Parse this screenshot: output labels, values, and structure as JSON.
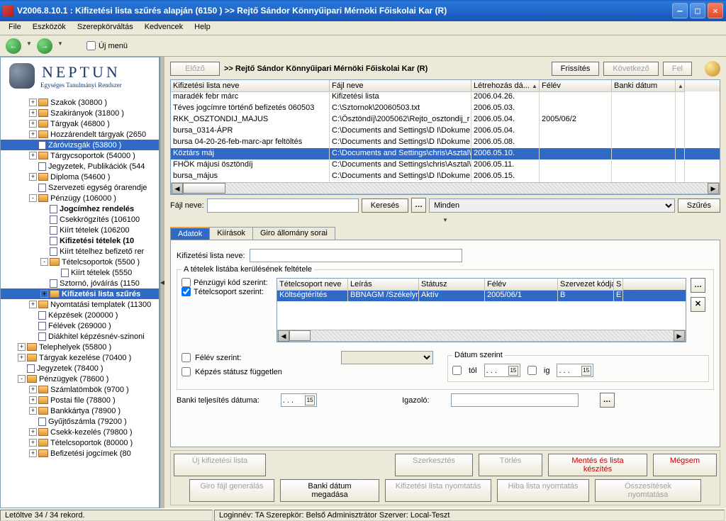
{
  "window": {
    "title": "V2006.8.10.1 : Kifizetési lista szűrés alapján (6150  )   >> Rejtő Sándor Könnyűipari Mérnöki Főiskolai Kar (R)"
  },
  "menu": [
    "File",
    "Eszközök",
    "Szerepkörváltás",
    "Kedvencek",
    "Help"
  ],
  "ujmenu": "Új menü",
  "logo": {
    "name": "NEPTUN",
    "sub": "Egységes Tanulmányi Rendszer"
  },
  "tree": [
    {
      "d": 2,
      "ex": "+",
      "i": "b",
      "t": "Szakok (30800  )"
    },
    {
      "d": 2,
      "ex": "+",
      "i": "b",
      "t": "Szakirányok (31800  )"
    },
    {
      "d": 2,
      "ex": "+",
      "i": "b",
      "t": "Tárgyak (46800  )"
    },
    {
      "d": 2,
      "ex": "+",
      "i": "b",
      "t": "Hozzárendelt tárgyak (2650"
    },
    {
      "d": 2,
      "ex": "",
      "i": "d",
      "t": "Záróvizsgák (53800  )",
      "sel": true
    },
    {
      "d": 2,
      "ex": "+",
      "i": "b",
      "t": "Tárgycsoportok (54000  )"
    },
    {
      "d": 2,
      "ex": "",
      "i": "d",
      "t": "Jegyzetek, Publikációk (544"
    },
    {
      "d": 2,
      "ex": "+",
      "i": "b",
      "t": "Diploma (54600  )"
    },
    {
      "d": 2,
      "ex": "",
      "i": "d",
      "t": "Szervezeti egység órarendje"
    },
    {
      "d": 2,
      "ex": "-",
      "i": "b",
      "t": "Pénzügy (106000  )"
    },
    {
      "d": 3,
      "ex": "",
      "i": "d",
      "t": "Jogcímhez rendelés",
      "bold": true
    },
    {
      "d": 3,
      "ex": "",
      "i": "d",
      "t": "Csekkrögzítés (106100"
    },
    {
      "d": 3,
      "ex": "",
      "i": "d",
      "t": "Kiírt tételek (106200"
    },
    {
      "d": 3,
      "ex": "",
      "i": "d",
      "t": "Kifizetési tételek (10",
      "bold": true
    },
    {
      "d": 3,
      "ex": "",
      "i": "d",
      "t": "Kiírt tételhez befizető rer"
    },
    {
      "d": 3,
      "ex": "-",
      "i": "b",
      "t": "Tételcsoportok (5500  )"
    },
    {
      "d": 4,
      "ex": "",
      "i": "d",
      "t": "Kiírt tételek (5550"
    },
    {
      "d": 3,
      "ex": "",
      "i": "d",
      "t": "Sztornó, jóváírás (1150"
    },
    {
      "d": 3,
      "ex": "+",
      "i": "b",
      "t": "Kifizetési lista szűrés",
      "sel": true,
      "bold": true
    },
    {
      "d": 2,
      "ex": "+",
      "i": "b",
      "t": "Nyomtatási templatek (11300"
    },
    {
      "d": 2,
      "ex": "",
      "i": "d",
      "t": "Képzések (200000  )"
    },
    {
      "d": 2,
      "ex": "",
      "i": "d",
      "t": "Félévek (269000  )"
    },
    {
      "d": 2,
      "ex": "",
      "i": "d",
      "t": "Diákhitel képzésnév-szinoni"
    },
    {
      "d": 1,
      "ex": "+",
      "i": "b",
      "t": "Telephelyek (55800  )"
    },
    {
      "d": 1,
      "ex": "+",
      "i": "b",
      "t": "Tárgyak kezelése (70400  )"
    },
    {
      "d": 1,
      "ex": "",
      "i": "d",
      "t": "Jegyzetek (78400  )"
    },
    {
      "d": 1,
      "ex": "-",
      "i": "b",
      "t": "Pénzügyek (78600  )"
    },
    {
      "d": 2,
      "ex": "+",
      "i": "b",
      "t": "Számlatömbök (9700  )"
    },
    {
      "d": 2,
      "ex": "+",
      "i": "b",
      "t": "Postai file (78800  )"
    },
    {
      "d": 2,
      "ex": "+",
      "i": "b",
      "t": "Bankkártya (78900  )"
    },
    {
      "d": 2,
      "ex": "",
      "i": "d",
      "t": "Gyűjtőszámla (79200  )"
    },
    {
      "d": 2,
      "ex": "+",
      "i": "b",
      "t": "Csekk-kezelés (79800  )"
    },
    {
      "d": 2,
      "ex": "+",
      "i": "b",
      "t": "Tételcsoportok (80000  )"
    },
    {
      "d": 2,
      "ex": "+",
      "i": "b",
      "t": "Befizetési jogcímek (80"
    }
  ],
  "topbtns": {
    "prev": "Előző",
    "path": ">> Rejtő Sándor Könnyűipari Mérnöki Főiskolai Kar (R)",
    "refresh": "Frissítés",
    "next": "Következő",
    "up": "Fel"
  },
  "tableHeaders": [
    "Kifizetési lista neve",
    "Fájl neve",
    "Létrehozás dá...",
    "Félév",
    "Banki dátum"
  ],
  "rows": [
    {
      "n": "maradék febr márc",
      "f": "Kifizetési lista",
      "d": "2006.04.26.",
      "fv": "",
      "b": ""
    },
    {
      "n": "Téves jogcímre történő befizetés 060503",
      "f": "C:\\Sztornok\\20060503.txt",
      "d": "2006.05.03.",
      "fv": "",
      "b": ""
    },
    {
      "n": "RKK_OSZTONDIJ_MAJUS",
      "f": "C:\\Ösztöndíj\\2005062\\Rejto_osztondij_r",
      "d": "2006.05.04.",
      "fv": "2005/06/2",
      "b": ""
    },
    {
      "n": "bursa_0314-ÁPR",
      "f": "C:\\Documents and Settings\\D I\\Dokume",
      "d": "2006.05.04.",
      "fv": "",
      "b": ""
    },
    {
      "n": "bursa 04-20-26-feb-marc-apr feltöltés",
      "f": "C:\\Documents and Settings\\D I\\Dokume",
      "d": "2006.05.08.",
      "fv": "",
      "b": ""
    },
    {
      "n": "Köztárs máj",
      "f": "C:\\Documents and Settings\\chris\\Asztal\\",
      "d": "2006.05.10.",
      "fv": "",
      "b": "",
      "sel": true
    },
    {
      "n": "FHÖK májusi ösztöndíj",
      "f": "C:\\Documents and Settings\\chris\\Asztal\\",
      "d": "2006.05.11.",
      "fv": "",
      "b": ""
    },
    {
      "n": "bursa_május",
      "f": "C:\\Documents and Settings\\D I\\Dokume",
      "d": "2006.05.15.",
      "fv": "",
      "b": ""
    }
  ],
  "search": {
    "label": "Fájl neve:",
    "btn": "Keresés",
    "all": "Minden",
    "filter": "Szűrés"
  },
  "tabs": [
    "Adatok",
    "Kiírások",
    "Giro állomány sorai"
  ],
  "detail": {
    "nameLabel": "Kifizetési lista neve:",
    "groupTitle": "A tételek listába kerülésének feltétele",
    "chk1": "Pénzügyi kód szerint:",
    "chk2": "Tételcsoport szerint:",
    "detHeaders": [
      "Tételcsoport neve",
      "Leírás",
      "Státusz",
      "Félév",
      "Szervezet kódja",
      "S"
    ],
    "detRow": {
      "tn": "Költségtérítés",
      "le": "BBNAGM /Székelyn",
      "st": "Aktív",
      "fv": "2005/06/1",
      "sk": "B",
      "s": "E"
    },
    "felev": "Félév szerint:",
    "kepzes": "Képzés státusz független",
    "datumGroup": "Dátum szerint",
    "tol": "tól",
    "ig": "ig",
    "datedots": ".   .   .",
    "banki": "Banki teljesítés dátuma:",
    "igazolo": "Igazoló:"
  },
  "bottomBtns": {
    "uj": "Új kifizetési lista",
    "szerk": "Szerkesztés",
    "torl": "Törlés",
    "mentes": "Mentés és lista készítés",
    "megsem": "Mégsem",
    "giro": "Giro fájl generálás",
    "bankid": "Banki dátum megadása",
    "kif": "Kifizetési lista nyomtatás",
    "hiba": "Hiba lista nyomtatás",
    "ossz": "Összesítések nyomtatása"
  },
  "status": {
    "s1": "Letöltve 34 / 34 rekord.",
    "s2": "Loginnév: TA   Szerepkör: Belső Adminisztrátor   Szerver: Local-Teszt"
  }
}
